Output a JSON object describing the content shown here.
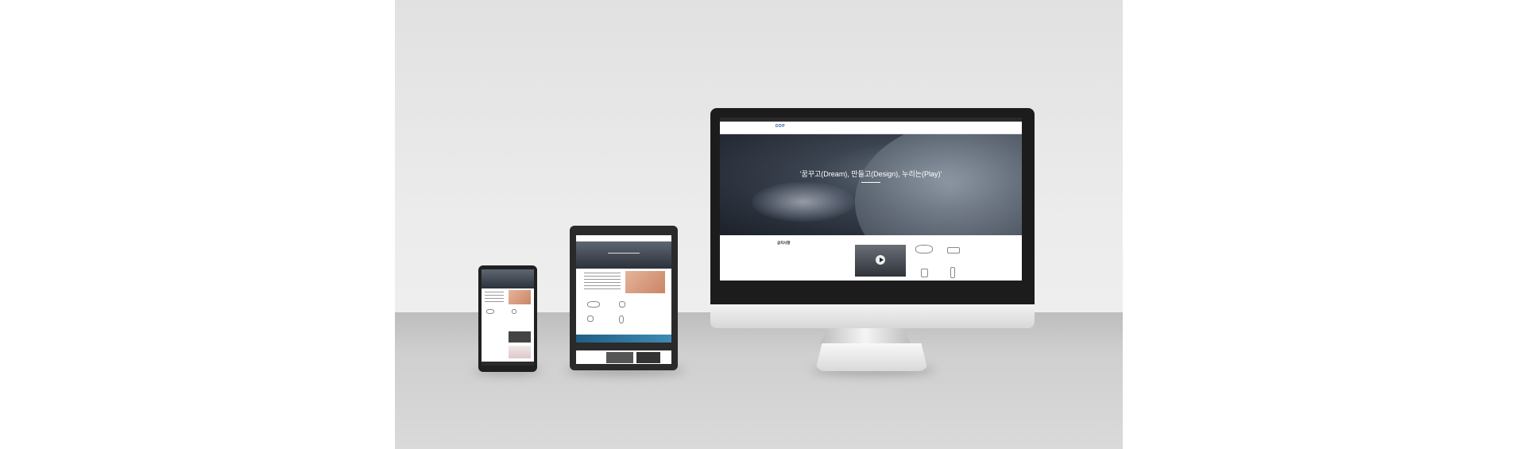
{
  "monitor": {
    "site": {
      "logo": "DDP",
      "menu": [
        "",
        "",
        "",
        "",
        ""
      ],
      "hero_title": "'꿈꾸고(Dream), 만들고(Design), 누리는(Play)'",
      "hero_sub": "",
      "news_title": "공지사항",
      "news_more": "",
      "news_items": [
        "",
        "",
        "",
        "",
        "",
        "",
        "",
        ""
      ],
      "video_title": "",
      "video_caption": "",
      "quick_labels": [
        "",
        ""
      ]
    }
  },
  "tablet": {
    "label": ""
  },
  "phone": {
    "label": ""
  },
  "colors": {
    "background": "#e6e6e6",
    "floor": "#c8c8c8",
    "device_dark": "#1c1c1c",
    "brand": "#2a5c9a"
  }
}
